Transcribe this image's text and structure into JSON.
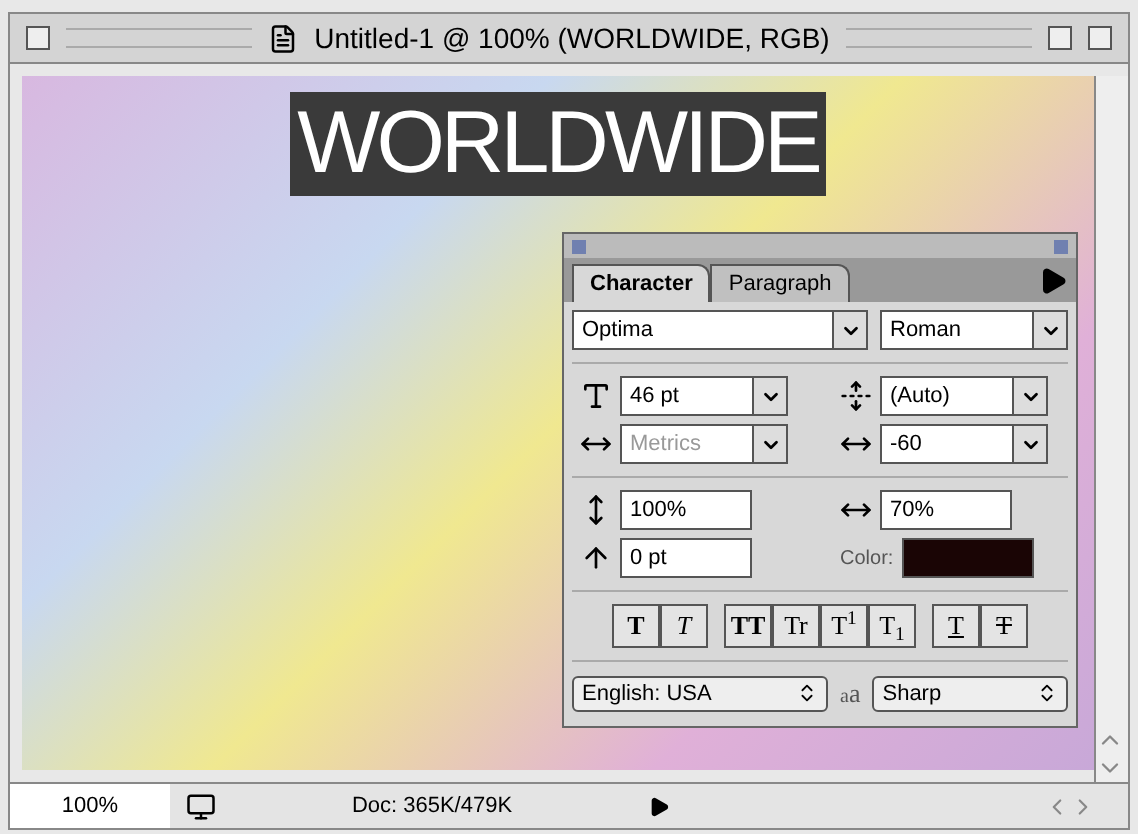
{
  "window": {
    "title": "Untitled-1 @ 100% (WORLDWIDE, RGB)"
  },
  "canvas": {
    "text": "WORLDWIDE"
  },
  "palette": {
    "tabs": [
      {
        "label": "Character",
        "selected": true
      },
      {
        "label": "Paragraph",
        "selected": false
      }
    ],
    "font": "Optima",
    "style": "Roman",
    "fields": [
      {
        "kind": "size",
        "value": "46 pt",
        "disabled": false
      },
      {
        "kind": "leading",
        "value": "(Auto)",
        "disabled": false
      },
      {
        "kind": "kerning",
        "value": "Metrics",
        "disabled": true
      },
      {
        "kind": "tracking",
        "value": "-60",
        "disabled": false
      }
    ],
    "scale": [
      {
        "kind": "vscale",
        "value": "100%"
      },
      {
        "kind": "hscale",
        "value": "70%"
      }
    ],
    "baseline": "0 pt",
    "color_label": "Color:",
    "color": "#1a0505",
    "style_groups": [
      [
        {
          "kind": "bold",
          "label": "T"
        },
        {
          "kind": "italic",
          "label": "T"
        }
      ],
      [
        {
          "kind": "caps",
          "label": "TT"
        },
        {
          "kind": "smallcaps",
          "label": "Tr"
        },
        {
          "kind": "super",
          "label": "T$^{1}$"
        },
        {
          "kind": "sub",
          "label": "T$_{1}$"
        }
      ],
      [
        {
          "kind": "underline",
          "label": "T"
        },
        {
          "kind": "strike",
          "label": "T"
        }
      ]
    ],
    "language": "English: USA",
    "antialias_symbol": [
      "a",
      "a"
    ],
    "antialias": "Sharp"
  },
  "status": {
    "zoom": "100%",
    "doc": "Doc: 365K/479K"
  }
}
